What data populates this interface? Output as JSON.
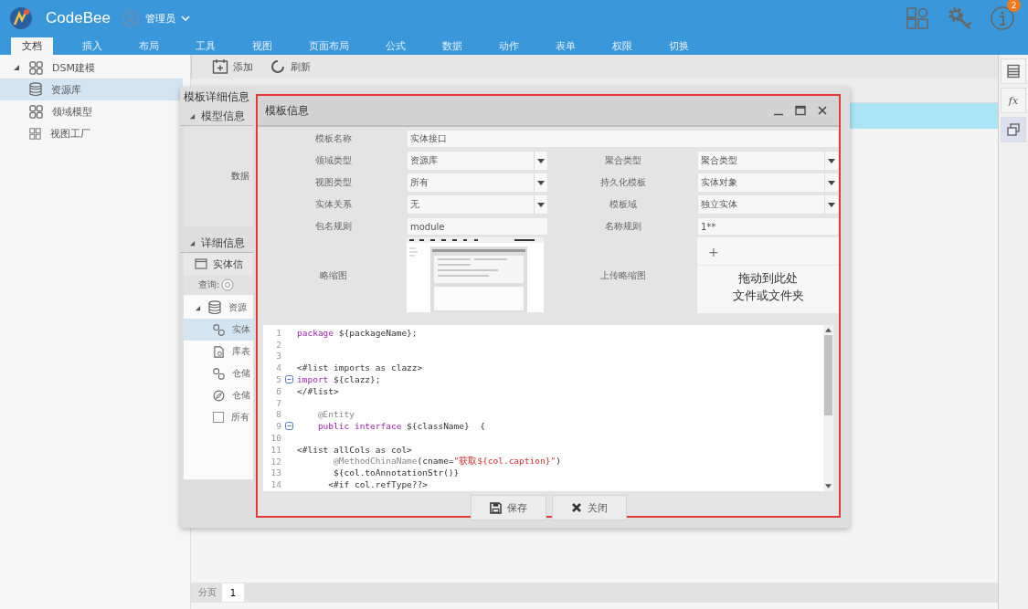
{
  "header": {
    "logo_text": "CodeBee",
    "user": {
      "name": "管理员"
    },
    "notification_count": "2"
  },
  "ribbon_tabs": [
    {
      "label": "文档",
      "selected": true
    },
    {
      "label": "插入",
      "selected": false
    },
    {
      "label": "布局",
      "selected": false
    },
    {
      "label": "工具",
      "selected": false
    },
    {
      "label": "视图",
      "selected": false
    },
    {
      "label": "页面布局",
      "selected": false
    },
    {
      "label": "公式",
      "selected": false
    },
    {
      "label": "数据",
      "selected": false
    },
    {
      "label": "动作",
      "selected": false
    },
    {
      "label": "表单",
      "selected": false
    },
    {
      "label": "权限",
      "selected": false
    },
    {
      "label": "切换",
      "selected": false
    }
  ],
  "sidebar": {
    "tree": [
      {
        "label": "DSM建模",
        "kind": "grid",
        "expanded": true,
        "selected": false,
        "children": [
          {
            "label": "资源库",
            "kind": "database",
            "selected": true
          },
          {
            "label": "领域模型",
            "kind": "grid",
            "selected": false
          },
          {
            "label": "视图工厂",
            "kind": "grid-small",
            "selected": false
          }
        ]
      }
    ]
  },
  "toolbar": {
    "buttons": [
      {
        "label": "添加",
        "kind": "add"
      },
      {
        "label": "刷新",
        "kind": "refresh"
      }
    ]
  },
  "grid": {
    "rows": [
      {
        "selected": true
      }
    ]
  },
  "pager": {
    "label": "分页",
    "page": "1"
  },
  "right_toolbar": [
    {
      "kind": "table",
      "selected": false
    },
    {
      "kind": "formula",
      "glyph": "fx",
      "selected": false
    },
    {
      "kind": "windows",
      "selected": true
    }
  ],
  "outer_dialog": {
    "title": "模板详细信息",
    "model_section": {
      "label": "模型信息",
      "expanded": true,
      "field_label": "数据"
    },
    "detail_section": {
      "label": "详细信息",
      "expanded": true,
      "tab": "实体信",
      "query_label": "查询:",
      "tree": [
        {
          "label": "资源",
          "kind": "database",
          "expanded": true,
          "selected": false
        },
        {
          "label": "实体",
          "kind": "link",
          "selected": true
        },
        {
          "label": "库表",
          "kind": "document",
          "selected": false
        },
        {
          "label": "仓储",
          "kind": "link",
          "selected": false
        },
        {
          "label": "仓储",
          "kind": "compass",
          "selected": false
        },
        {
          "label": "所有",
          "kind": "checkbox",
          "selected": false
        }
      ]
    }
  },
  "inner_dialog": {
    "title": "模板信息",
    "name_field": {
      "label": "模板名称",
      "value": "实体接口"
    },
    "rows": [
      [
        {
          "label": "领域类型",
          "value": "资源库",
          "kind": "select"
        },
        {
          "label": "聚合类型",
          "value": "聚合类型",
          "kind": "select"
        }
      ],
      [
        {
          "label": "视图类型",
          "value": "所有",
          "kind": "select"
        },
        {
          "label": "持久化模板",
          "value": "实体对象",
          "kind": "select"
        }
      ],
      [
        {
          "label": "实体关系",
          "value": "无",
          "kind": "select"
        },
        {
          "label": "模板域",
          "value": "独立实体",
          "kind": "select"
        }
      ],
      [
        {
          "label": "包名规则",
          "value": "module",
          "kind": "text"
        },
        {
          "label": "名称规则",
          "value": "1**",
          "kind": "text"
        }
      ]
    ],
    "thumbnail": {
      "label": "略缩图"
    },
    "upload": {
      "label": "上传略缩图",
      "plus": "+",
      "hint_lines": [
        "拖动到此处",
        "文件或文件夹"
      ]
    },
    "code_lines": [
      {
        "number": "1",
        "tokens": [
          {
            "kind": "keyword",
            "text": "package"
          },
          {
            "kind": "plain",
            "text": " ${packageName};"
          }
        ]
      },
      {
        "number": "2"
      },
      {
        "number": "3"
      },
      {
        "number": "4",
        "tokens": [
          {
            "kind": "plain",
            "text": "<#list imports as clazz>"
          }
        ]
      },
      {
        "number": "5",
        "fold": true,
        "tokens": [
          {
            "kind": "keyword",
            "text": "import"
          },
          {
            "kind": "plain",
            "text": " ${clazz};"
          }
        ]
      },
      {
        "number": "6",
        "tokens": [
          {
            "kind": "plain",
            "text": "</#list>"
          }
        ]
      },
      {
        "number": "7"
      },
      {
        "number": "8",
        "tokens": [
          {
            "kind": "annotation",
            "text": "    @Entity"
          }
        ]
      },
      {
        "number": "9",
        "fold": true,
        "tokens": [
          {
            "kind": "keyword",
            "text": "    public interface"
          },
          {
            "kind": "plain",
            "text": " ${className}  {"
          }
        ]
      },
      {
        "number": "10"
      },
      {
        "number": "11",
        "tokens": [
          {
            "kind": "plain",
            "text": "<#list allCols as col>"
          }
        ]
      },
      {
        "number": "12",
        "tokens": [
          {
            "kind": "annotation",
            "text": "       @MethodChinaName"
          },
          {
            "kind": "plain",
            "text": "(cname="
          },
          {
            "kind": "string",
            "text": "\"获取${col.caption}\""
          },
          {
            "kind": "plain",
            "text": ")"
          }
        ]
      },
      {
        "number": "13",
        "tokens": [
          {
            "kind": "plain",
            "text": "       ${col.toAnnotationStr()}"
          }
        ]
      },
      {
        "number": "14",
        "tokens": [
          {
            "kind": "plain",
            "text": "      <#if col.refType??>"
          }
        ]
      }
    ],
    "buttons": [
      {
        "label": "保存",
        "kind": "save"
      },
      {
        "label": "关闭",
        "kind": "close"
      }
    ]
  }
}
